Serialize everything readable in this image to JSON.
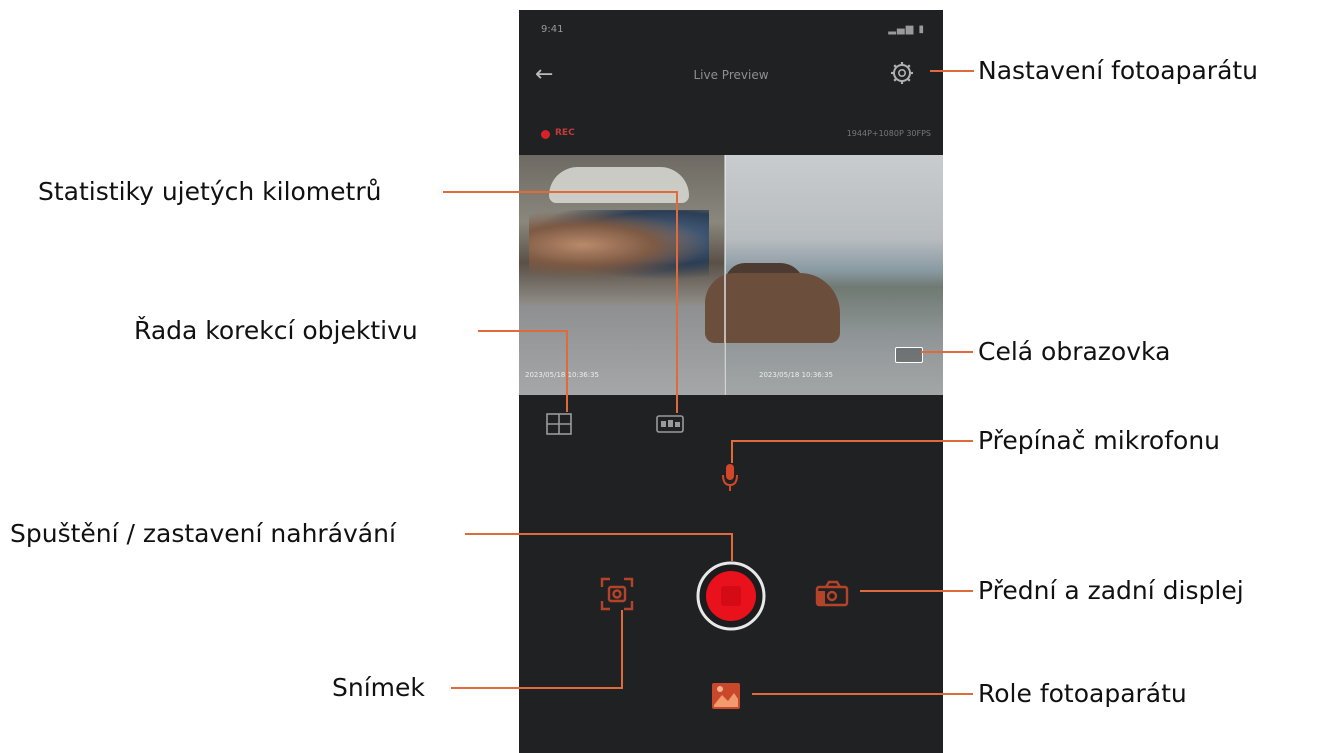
{
  "status_bar": {
    "time": "9:41",
    "signal": "▂▄▆ ▮"
  },
  "header": {
    "title": "Live Preview",
    "back_glyph": "←"
  },
  "recording": {
    "label": "REC",
    "resolution": "1944P+1080P 30FPS"
  },
  "preview": {
    "left_timestamp": "2023/05/18 10:36:35",
    "right_timestamp": "2023/05/18 10:36:35"
  },
  "callouts": {
    "camera_settings": "Nastavení fotoaparátu",
    "mileage_stats": "Statistiky ujetých kilometrů",
    "lens_correction": "Řada korekcí objektivu",
    "fullscreen": "Celá obrazovka",
    "mic_toggle": "Přepínač mikrofonu",
    "record_toggle": "Spuštění / zastavení nahrávání",
    "front_rear_display": "Přední a zadní displej",
    "snapshot": "Snímek",
    "camera_roll": "Role fotoaparátu"
  },
  "colors": {
    "accent": "#e0502a",
    "record_red": "#e8111c",
    "phone_bg": "#202123",
    "leader_line": "#e06a3a"
  },
  "icons": [
    "gear-icon",
    "back-arrow-icon",
    "grid-icon",
    "mileage-icon",
    "microphone-icon",
    "record-icon",
    "snapshot-icon",
    "camera-switch-icon",
    "gallery-icon",
    "fullscreen-icon"
  ]
}
